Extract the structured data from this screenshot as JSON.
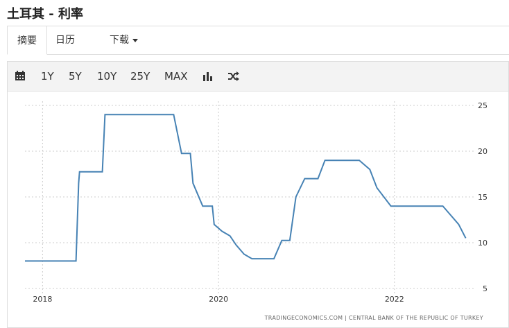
{
  "page": {
    "title": "土耳其 - 利率"
  },
  "tabs": [
    {
      "label": "摘要",
      "active": true
    },
    {
      "label": "日历",
      "active": false
    },
    {
      "label": "下载",
      "active": false
    }
  ],
  "toolbar": {
    "calendar_icon": "calendar-icon",
    "ranges": [
      "1Y",
      "5Y",
      "10Y",
      "25Y",
      "MAX"
    ],
    "chart_type_icon": "bar-chart-icon",
    "shuffle_icon": "shuffle-icon"
  },
  "colors": {
    "line": "#4682b4",
    "grid": "#cccccc",
    "toolbar_bg": "#f3f3f3"
  },
  "chart_data": {
    "type": "line",
    "title": "",
    "xlabel": "",
    "ylabel": "",
    "x_ticks": [
      "2018",
      "2020",
      "2022"
    ],
    "y_ticks": [
      5,
      10,
      15,
      20,
      25
    ],
    "ylim": [
      5,
      25
    ],
    "xlim": [
      2017.8,
      2022.9
    ],
    "y_axis_side": "right",
    "grid": "horizontal dotted",
    "source": "TRADINGECONOMICS.COM  |  CENTRAL BANK OF THE REPUBLIC OF TURKEY",
    "series": [
      {
        "color": "#4682b4",
        "points": [
          [
            2017.8,
            8.0
          ],
          [
            2018.38,
            8.0
          ],
          [
            2018.41,
            16.5
          ],
          [
            2018.42,
            17.75
          ],
          [
            2018.68,
            17.75
          ],
          [
            2018.71,
            24.0
          ],
          [
            2019.49,
            24.0
          ],
          [
            2019.58,
            19.75
          ],
          [
            2019.68,
            19.75
          ],
          [
            2019.71,
            16.5
          ],
          [
            2019.82,
            14.0
          ],
          [
            2019.93,
            14.0
          ],
          [
            2019.95,
            12.0
          ],
          [
            2020.04,
            11.25
          ],
          [
            2020.13,
            10.75
          ],
          [
            2020.2,
            9.75
          ],
          [
            2020.29,
            8.75
          ],
          [
            2020.38,
            8.25
          ],
          [
            2020.63,
            8.25
          ],
          [
            2020.72,
            10.25
          ],
          [
            2020.81,
            10.25
          ],
          [
            2020.88,
            15.0
          ],
          [
            2020.98,
            17.0
          ],
          [
            2021.13,
            17.0
          ],
          [
            2021.21,
            19.0
          ],
          [
            2021.6,
            19.0
          ],
          [
            2021.72,
            18.0
          ],
          [
            2021.8,
            16.0
          ],
          [
            2021.96,
            14.0
          ],
          [
            2022.55,
            14.0
          ],
          [
            2022.64,
            13.0
          ],
          [
            2022.73,
            12.0
          ],
          [
            2022.81,
            10.5
          ]
        ]
      }
    ]
  }
}
